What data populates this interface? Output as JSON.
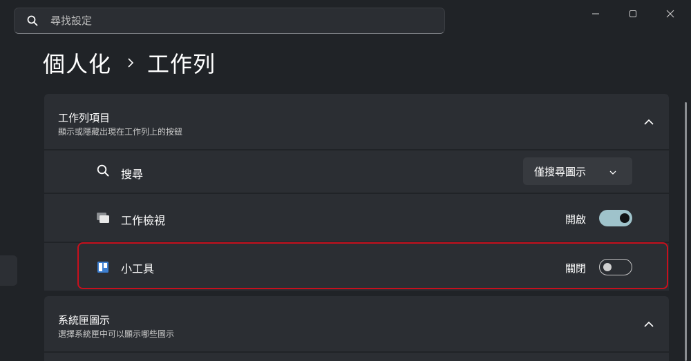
{
  "search": {
    "placeholder": "尋找設定"
  },
  "window_controls": {
    "minimize_icon": "minimize-icon",
    "maximize_icon": "maximize-icon",
    "close_icon": "close-icon"
  },
  "breadcrumb": {
    "parent": "個人化",
    "current": "工作列"
  },
  "taskbar_items": {
    "title": "工作列項目",
    "subtitle": "顯示或隱藏出現在工作列上的按鈕",
    "rows": [
      {
        "label": "搜尋",
        "icon": "search-icon",
        "control": "dropdown",
        "value": "僅搜尋圖示"
      },
      {
        "label": "工作檢視",
        "icon": "task-view-icon",
        "control": "toggle",
        "state_label": "開啟",
        "on": true
      },
      {
        "label": "小工具",
        "icon": "widgets-icon",
        "control": "toggle",
        "state_label": "關閉",
        "on": false
      }
    ]
  },
  "system_tray": {
    "title": "系統匣圖示",
    "subtitle": "選擇系統匣中可以顯示哪些圖示"
  },
  "colors": {
    "accent": "#9fc3cb",
    "highlight": "#c8101d",
    "background": "#202327",
    "card": "#2b2e33"
  }
}
